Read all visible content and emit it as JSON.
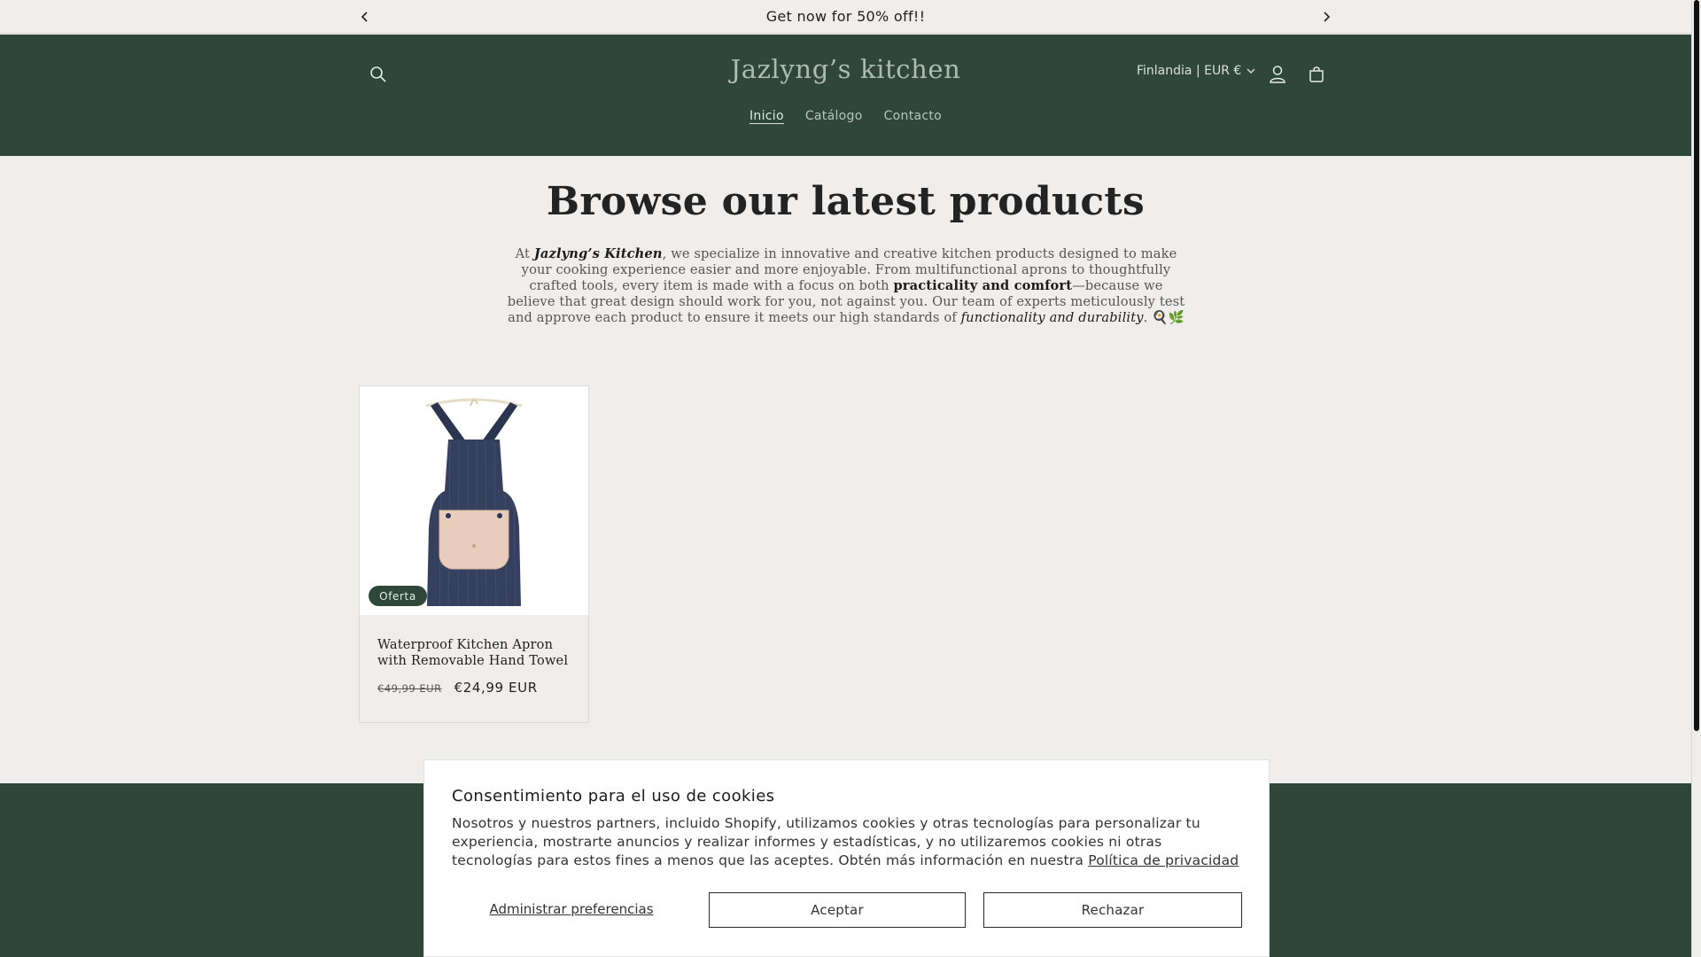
{
  "announcement": {
    "text": "Get now for 50% off!!"
  },
  "header": {
    "brand": "Jazlyng’s kitchen",
    "locale": "Finlandia | EUR €",
    "nav": [
      {
        "label": "Inicio",
        "active": true
      },
      {
        "label": "Catálogo",
        "active": false
      },
      {
        "label": "Contacto",
        "active": false
      }
    ]
  },
  "main": {
    "title": "Browse our latest products",
    "intro": {
      "p1": "At ",
      "brand": "Jazlyng’s Kitchen",
      "p2": ", we specialize in innovative and creative kitchen products designed to make your cooking experience easier and more enjoyable. From multifunctional aprons to thoughtfully crafted tools, every item is made with a focus on both ",
      "bold": "practicality and comfort",
      "p3": "—because we believe that great design should work for you, not against you. Our team of experts meticulously test and approve each product to ensure it meets our high standards of ",
      "italic": "functionality and durability",
      "p4": ". ",
      "emoji": "🍳🌿"
    }
  },
  "product": {
    "badge": "Oferta",
    "name": "Waterproof Kitchen Apron with Removable Hand Towel",
    "old_price": "€49,99 EUR",
    "price": "€24,99 EUR"
  },
  "cookie": {
    "title": "Consentimiento para el uso de cookies",
    "text": "Nosotros y nuestros partners, incluido Shopify, utilizamos cookies y otras tecnologías para personalizar tu experiencia, mostrarte anuncios y realizar informes y estadísticas, y no utilizaremos cookies ni otras tecnologías para estos fines a menos que las aceptes. Obtén más información en nuestra ",
    "policy_link": "Política de privacidad",
    "manage": "Administrar preferencias",
    "accept": "Aceptar",
    "reject": "Rechazar"
  },
  "colors": {
    "header_bg": "#2f463a",
    "page_bg": "#efeeec",
    "badge_bg": "#2f463a"
  },
  "icons": [
    "chevron-left-icon",
    "chevron-right-icon",
    "search-icon",
    "chevron-down-icon",
    "user-icon",
    "cart-icon"
  ]
}
